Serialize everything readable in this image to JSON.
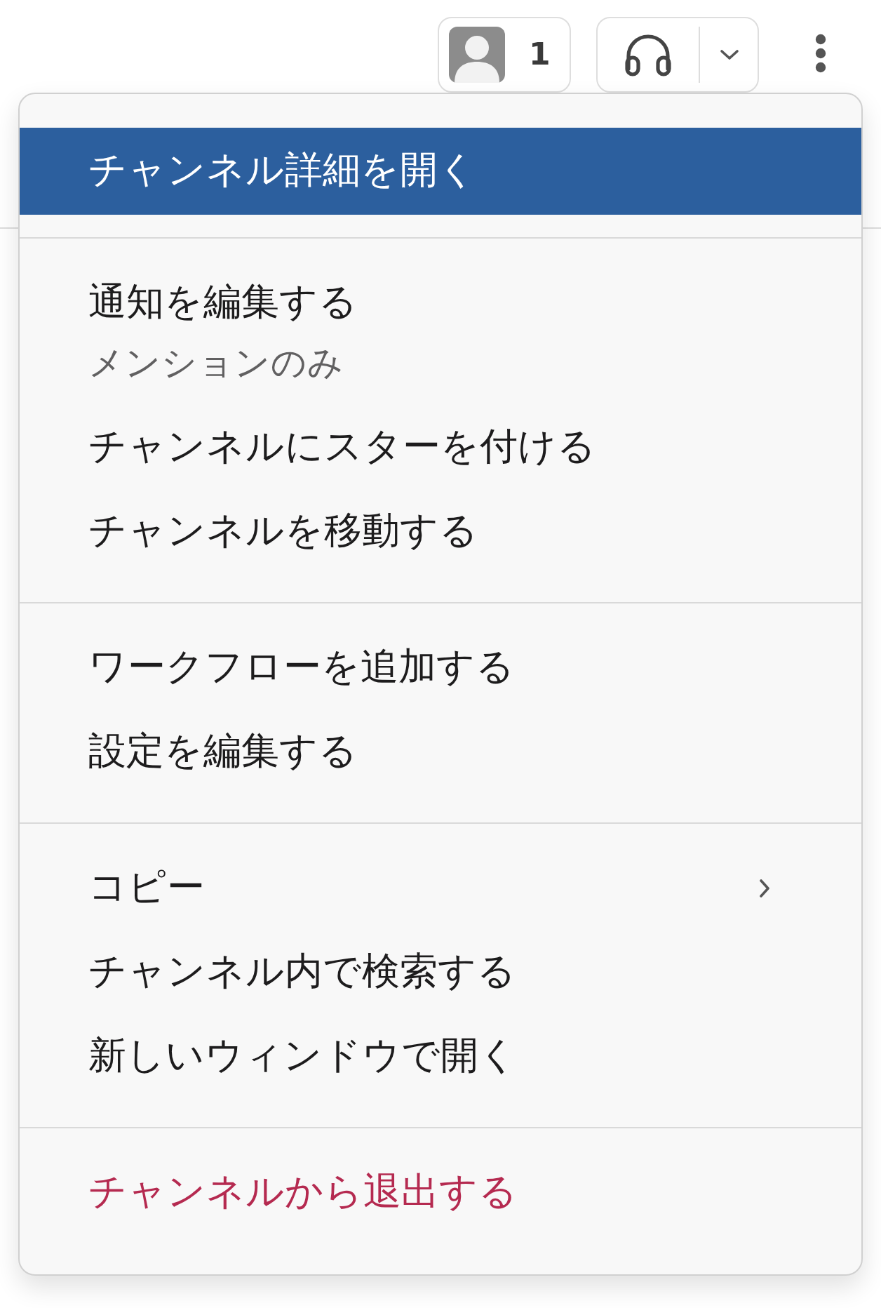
{
  "header": {
    "member_count": "1"
  },
  "menu": {
    "sections": [
      {
        "items": [
          {
            "kind": "action",
            "label": "チャンネル詳細を開く",
            "highlighted": true
          }
        ]
      },
      {
        "items": [
          {
            "kind": "action",
            "label": "通知を編集する",
            "sublabel": "メンションのみ",
            "highlighted": false
          },
          {
            "kind": "action",
            "label": "チャンネルにスターを付ける",
            "highlighted": false
          },
          {
            "kind": "action",
            "label": "チャンネルを移動する",
            "highlighted": false
          }
        ]
      },
      {
        "items": [
          {
            "kind": "action",
            "label": "ワークフローを追加する",
            "highlighted": false
          },
          {
            "kind": "action",
            "label": "設定を編集する",
            "highlighted": false
          }
        ]
      },
      {
        "items": [
          {
            "kind": "submenu",
            "label": "コピー",
            "highlighted": false
          },
          {
            "kind": "action",
            "label": "チャンネル内で検索する",
            "highlighted": false
          },
          {
            "kind": "action",
            "label": "新しいウィンドウで開く",
            "highlighted": false
          }
        ]
      },
      {
        "items": [
          {
            "kind": "danger",
            "label": "チャンネルから退出する",
            "highlighted": false
          }
        ]
      }
    ]
  }
}
